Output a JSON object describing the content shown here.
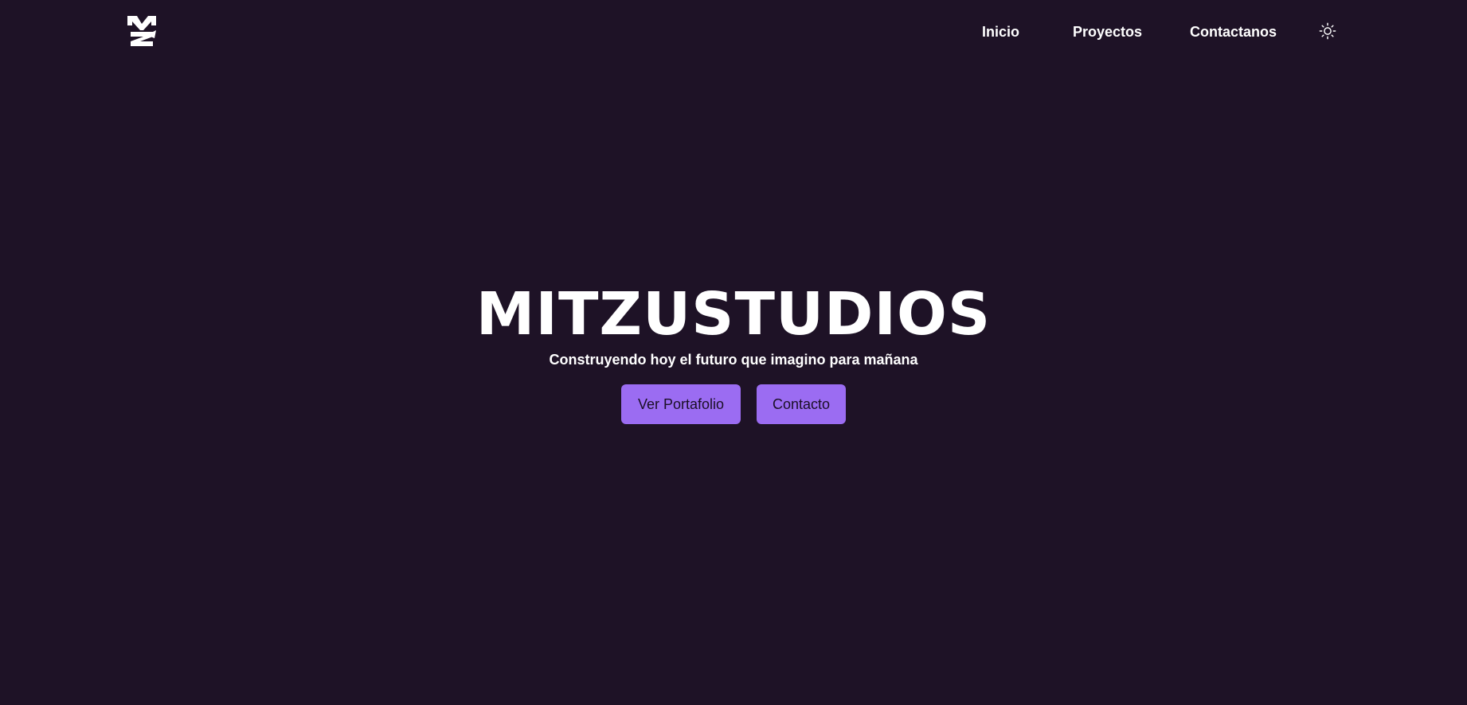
{
  "colors": {
    "background": "#1e1226",
    "accent": "#9b6cf2",
    "text": "#ffffff",
    "button_text": "#1a0f25"
  },
  "navbar": {
    "logo_icon": "mz-logo-icon",
    "links": [
      {
        "label": "Inicio"
      },
      {
        "label": "Proyectos"
      },
      {
        "label": "Contactanos"
      }
    ],
    "theme_toggle_icon": "sun-icon"
  },
  "hero": {
    "title": "MITZUSTUDIOS",
    "subtitle": "Construyendo hoy el futuro que imagino para mañana",
    "buttons": {
      "portfolio_label": "Ver Portafolio",
      "contact_label": "Contacto"
    }
  }
}
